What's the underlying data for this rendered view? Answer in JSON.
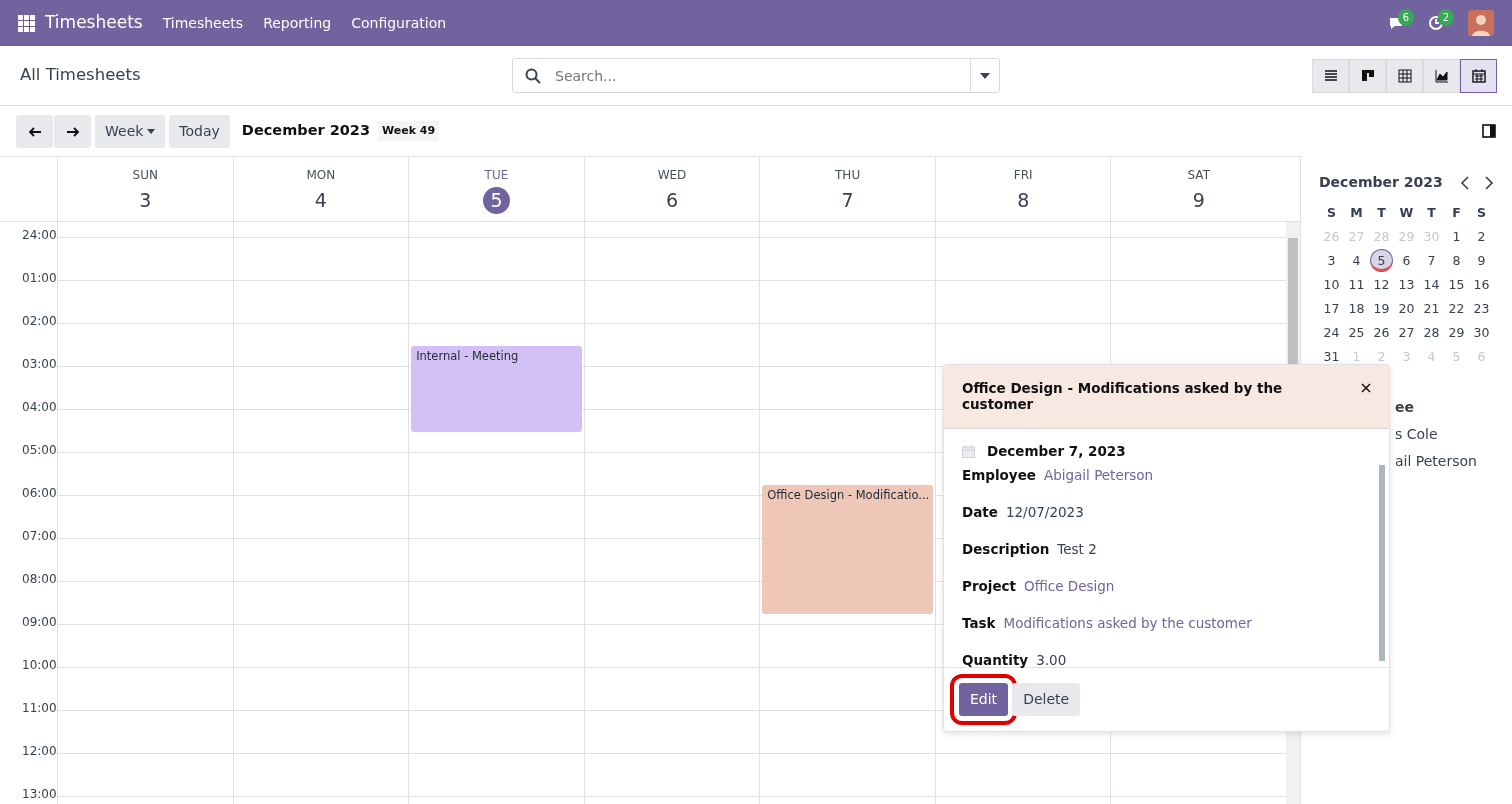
{
  "navbar": {
    "brand": "Timesheets",
    "menus": [
      "Timesheets",
      "Reporting",
      "Configuration"
    ],
    "messages_badge": "6",
    "activities_badge": "2"
  },
  "control_panel": {
    "title": "All Timesheets",
    "search": {
      "placeholder": "Search..."
    },
    "views": [
      {
        "kind": "list",
        "selected": false
      },
      {
        "kind": "kanban",
        "selected": false
      },
      {
        "kind": "pivot",
        "selected": false
      },
      {
        "kind": "graph",
        "selected": false
      },
      {
        "kind": "calendar",
        "selected": true
      }
    ]
  },
  "toolbar": {
    "scale": "Week",
    "today": "Today",
    "period": "December 2023",
    "week": "Week 49"
  },
  "days": [
    {
      "name": "SUN",
      "number": "3",
      "selected": false
    },
    {
      "name": "MON",
      "number": "4",
      "selected": false
    },
    {
      "name": "TUE",
      "number": "5",
      "selected": true
    },
    {
      "name": "WED",
      "number": "6",
      "selected": false
    },
    {
      "name": "THU",
      "number": "7",
      "selected": false
    },
    {
      "name": "FRI",
      "number": "8",
      "selected": false
    },
    {
      "name": "SAT",
      "number": "9",
      "selected": false
    }
  ],
  "hours": [
    "24:00",
    "01:00",
    "02:00",
    "03:00",
    "04:00",
    "05:00",
    "06:00",
    "07:00",
    "08:00",
    "09:00",
    "10:00",
    "11:00",
    "12:00",
    "13:00"
  ],
  "events": [
    {
      "title": "Internal - Meeting",
      "color": "#d3c1f5"
    },
    {
      "title": "Office Design - Modificatio...",
      "color": "#eec7b8"
    }
  ],
  "mini_calendar": {
    "title": "December 2023",
    "weekdays": [
      "S",
      "M",
      "T",
      "W",
      "T",
      "F",
      "S"
    ],
    "weeks": [
      [
        {
          "label": "26",
          "muted": true
        },
        {
          "label": "27",
          "muted": true
        },
        {
          "label": "28",
          "muted": true
        },
        {
          "label": "29",
          "muted": true
        },
        {
          "label": "30",
          "muted": true
        },
        {
          "label": "1",
          "muted": false
        },
        {
          "label": "2",
          "muted": false
        }
      ],
      [
        {
          "label": "3",
          "muted": false
        },
        {
          "label": "4",
          "muted": false
        },
        {
          "label": "5",
          "muted": false,
          "selected": true
        },
        {
          "label": "6",
          "muted": false
        },
        {
          "label": "7",
          "muted": false
        },
        {
          "label": "8",
          "muted": false
        },
        {
          "label": "9",
          "muted": false
        }
      ],
      [
        {
          "label": "10",
          "muted": false
        },
        {
          "label": "11",
          "muted": false
        },
        {
          "label": "12",
          "muted": false
        },
        {
          "label": "13",
          "muted": false
        },
        {
          "label": "14",
          "muted": false
        },
        {
          "label": "15",
          "muted": false
        },
        {
          "label": "16",
          "muted": false
        }
      ],
      [
        {
          "label": "17",
          "muted": false
        },
        {
          "label": "18",
          "muted": false
        },
        {
          "label": "19",
          "muted": false
        },
        {
          "label": "20",
          "muted": false
        },
        {
          "label": "21",
          "muted": false
        },
        {
          "label": "22",
          "muted": false
        },
        {
          "label": "23",
          "muted": false
        }
      ],
      [
        {
          "label": "24",
          "muted": false
        },
        {
          "label": "25",
          "muted": false
        },
        {
          "label": "26",
          "muted": false
        },
        {
          "label": "27",
          "muted": false
        },
        {
          "label": "28",
          "muted": false
        },
        {
          "label": "29",
          "muted": false
        },
        {
          "label": "30",
          "muted": false
        }
      ],
      [
        {
          "label": "31",
          "muted": false
        },
        {
          "label": "1",
          "muted": true
        },
        {
          "label": "2",
          "muted": true
        },
        {
          "label": "3",
          "muted": true
        },
        {
          "label": "4",
          "muted": true
        },
        {
          "label": "5",
          "muted": true
        },
        {
          "label": "6",
          "muted": true
        }
      ]
    ]
  },
  "filter": {
    "heading": "ee",
    "items": [
      "s Cole",
      "ail Peterson"
    ]
  },
  "popover": {
    "title": "Office Design - Modifications asked by the customer",
    "date": "December 7, 2023",
    "fields": [
      {
        "label": "Employee",
        "value": "Abigail Peterson",
        "kind": "link"
      },
      {
        "label": "Date",
        "value": "12/07/2023",
        "kind": "text"
      },
      {
        "label": "Description",
        "value": "Test 2",
        "kind": "text"
      },
      {
        "label": "Project",
        "value": "Office Design",
        "kind": "link"
      },
      {
        "label": "Task",
        "value": "Modifications asked by the customer",
        "kind": "link"
      },
      {
        "label": "Quantity",
        "value": "3.00",
        "kind": "text"
      }
    ],
    "buttons": [
      {
        "label": "Edit",
        "kind": "primary",
        "highlighted": true
      },
      {
        "label": "Delete",
        "kind": "secondary",
        "highlighted": false
      }
    ]
  }
}
